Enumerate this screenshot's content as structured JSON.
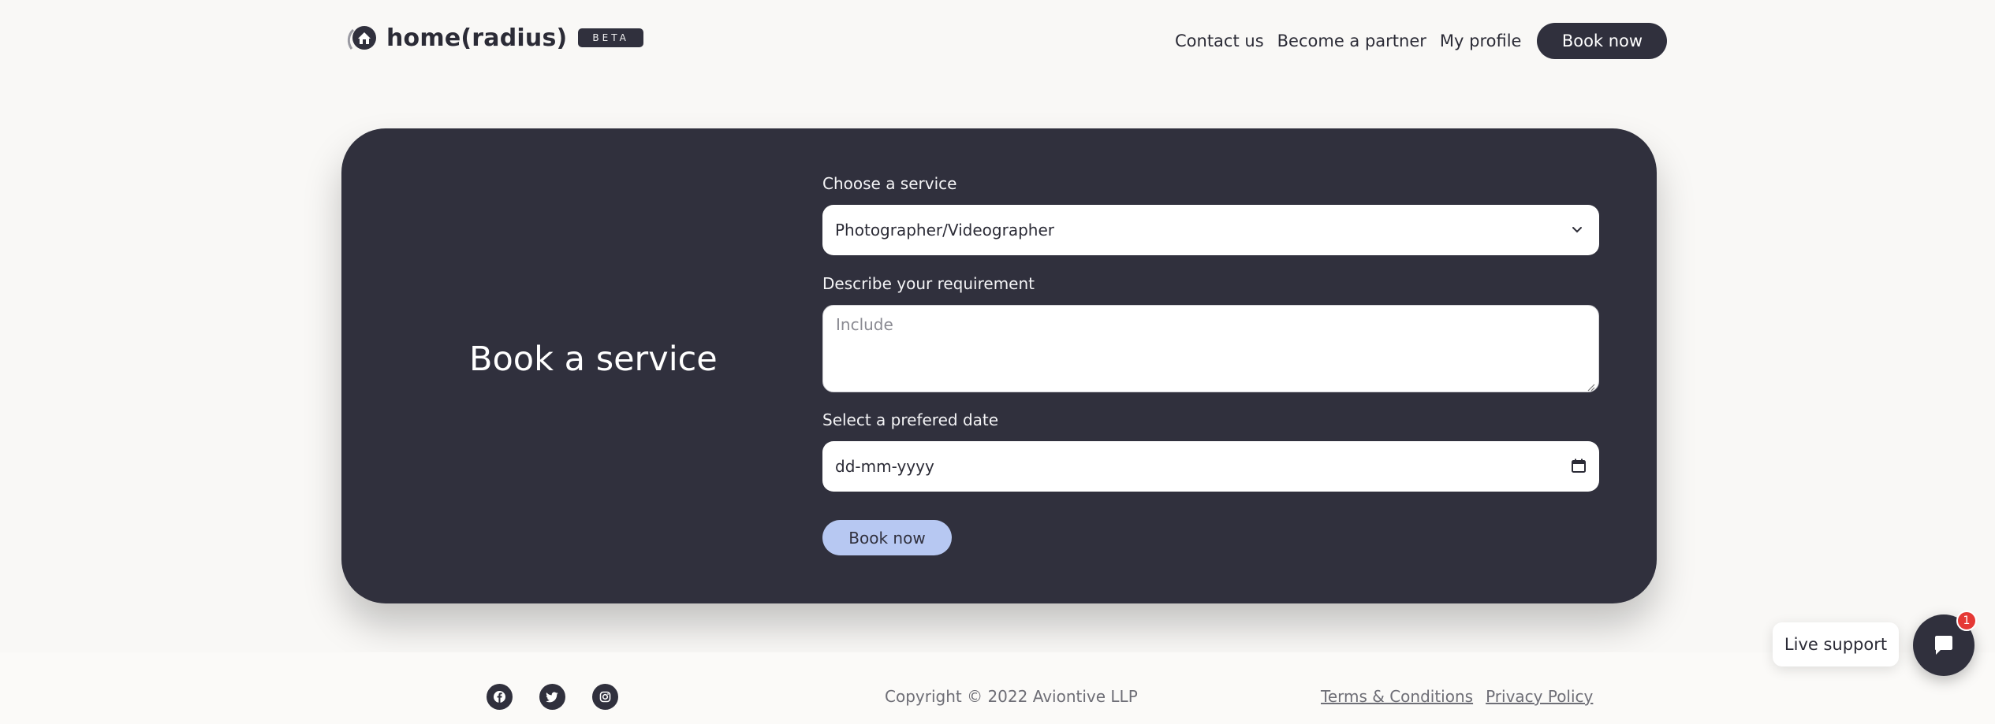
{
  "header": {
    "brand_name": "home(radius)",
    "beta_label": "BETA",
    "nav": {
      "contact": "Contact us",
      "partner": "Become a partner",
      "profile": "My profile",
      "book_now": "Book now"
    }
  },
  "booking_card": {
    "title": "Book a service",
    "service_label": "Choose a service",
    "service_value": "Photographer/Videographer",
    "requirement_label": "Describe your requirement",
    "requirement_placeholder": "Include",
    "date_label": "Select a prefered date",
    "date_value": "dd-mm-yyyy",
    "submit_label": "Book now"
  },
  "footer": {
    "social_icons": [
      "facebook-icon",
      "twitter-icon",
      "instagram-icon"
    ],
    "copyright": "Copyright © 2022 Aviontive LLP",
    "terms": "Terms & Conditions",
    "privacy": "Privacy Policy"
  },
  "support": {
    "label": "Live support",
    "badge_count": "1"
  },
  "colors": {
    "background": "#f9f8f6",
    "dark": "#30303d",
    "accent_button": "#b7c8f2",
    "badge": "#e53935"
  }
}
